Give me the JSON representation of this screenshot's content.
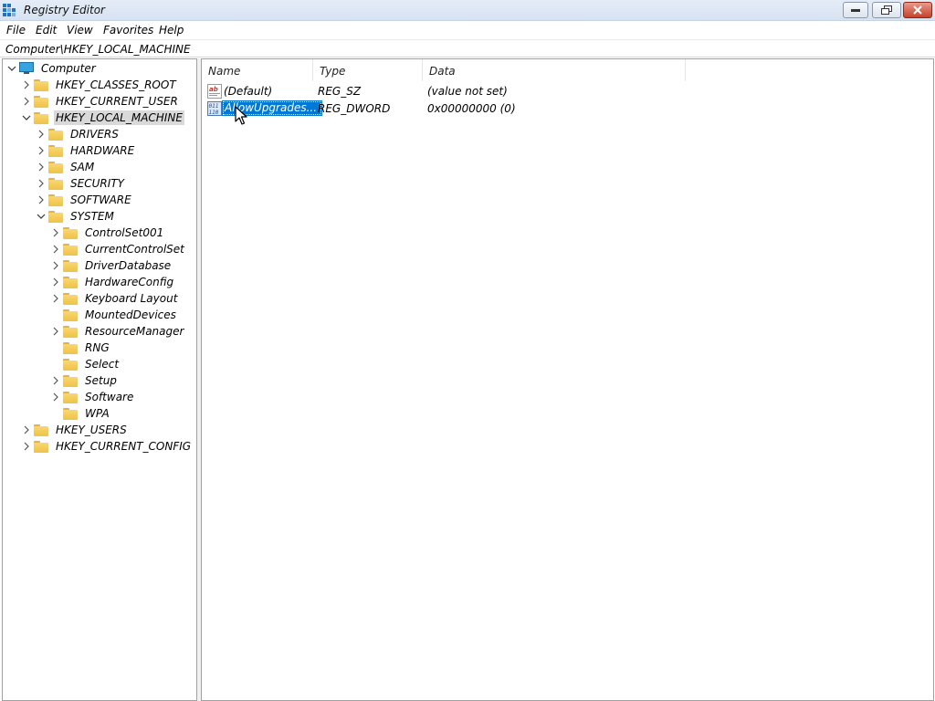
{
  "window": {
    "title": "Registry Editor",
    "icon": "regedit-icon",
    "controls": {
      "minimize": "minimize-icon",
      "restore": "restore-icon",
      "close": "close-icon"
    }
  },
  "menu": [
    "File",
    "Edit",
    "View",
    "Favorites",
    "Help"
  ],
  "address": "Computer\\HKEY_LOCAL_MACHINE",
  "tree": {
    "root": "Computer",
    "items": [
      {
        "label": "HKEY_CLASSES_ROOT",
        "state": "collapsed"
      },
      {
        "label": "HKEY_CURRENT_USER",
        "state": "collapsed"
      },
      {
        "label": "HKEY_LOCAL_MACHINE",
        "state": "expanded",
        "selected": true
      },
      {
        "label": "DRIVERS",
        "state": "collapsed"
      },
      {
        "label": "HARDWARE",
        "state": "collapsed"
      },
      {
        "label": "SAM",
        "state": "collapsed"
      },
      {
        "label": "SECURITY",
        "state": "collapsed"
      },
      {
        "label": "SOFTWARE",
        "state": "collapsed"
      },
      {
        "label": "SYSTEM",
        "state": "expanded"
      },
      {
        "label": "ControlSet001",
        "state": "collapsed"
      },
      {
        "label": "CurrentControlSet",
        "state": "collapsed"
      },
      {
        "label": "DriverDatabase",
        "state": "collapsed"
      },
      {
        "label": "HardwareConfig",
        "state": "collapsed"
      },
      {
        "label": "Keyboard Layout",
        "state": "collapsed"
      },
      {
        "label": "MountedDevices",
        "state": "leaf"
      },
      {
        "label": "ResourceManager",
        "state": "collapsed"
      },
      {
        "label": "RNG",
        "state": "leaf"
      },
      {
        "label": "Select",
        "state": "leaf"
      },
      {
        "label": "Setup",
        "state": "collapsed"
      },
      {
        "label": "Software",
        "state": "collapsed"
      },
      {
        "label": "WPA",
        "state": "leaf"
      },
      {
        "label": "HKEY_USERS",
        "state": "collapsed"
      },
      {
        "label": "HKEY_CURRENT_CONFIG",
        "state": "collapsed"
      }
    ]
  },
  "list": {
    "columns": [
      "Name",
      "Type",
      "Data"
    ],
    "rows": [
      {
        "name": "(Default)",
        "type": "REG_SZ",
        "data": "(value not set)",
        "icon": "string-value-icon"
      },
      {
        "name": "AllowUpgrades...",
        "type": "REG_DWORD",
        "data": "0x00000000 (0)",
        "icon": "binary-value-icon",
        "selected": true
      }
    ]
  },
  "colors": {
    "selection": "#0078d7",
    "folder": "#f4c84f",
    "tree_selection": "#d9d9d9"
  }
}
